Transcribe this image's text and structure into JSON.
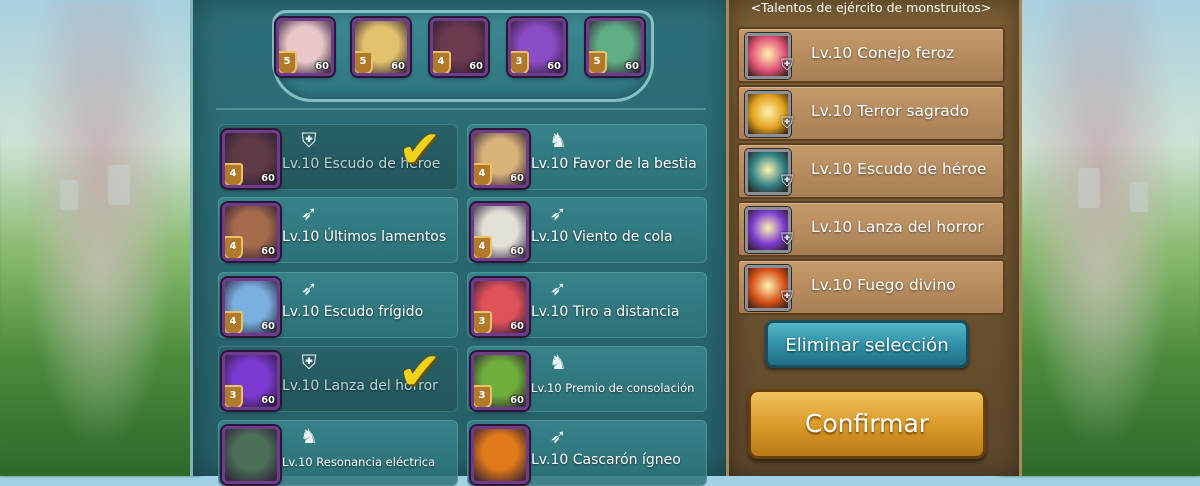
{
  "right_panel": {
    "title": "<Talentos de ejército de monstruitos>",
    "talents": [
      {
        "name": "Lv.10 Conejo feroz",
        "icon": "rabbit-talent-icon",
        "color": "#e3557a"
      },
      {
        "name": "Lv.10 Terror sagrado",
        "icon": "holy-terror-icon",
        "color": "#e0a21e"
      },
      {
        "name": "Lv.10 Escudo de héroe",
        "icon": "hero-shield-icon",
        "color": "#2f7f86"
      },
      {
        "name": "Lv.10 Lanza del horror",
        "icon": "horror-spear-icon",
        "color": "#7b3ad1"
      },
      {
        "name": "Lv.10 Fuego divino",
        "icon": "divine-fire-icon",
        "color": "#d8531a"
      }
    ],
    "clear_button": "Eliminar selección",
    "confirm_button": "Confirmar"
  },
  "squad": [
    {
      "stars": "5",
      "level": "60",
      "color": "#e9c7c9"
    },
    {
      "stars": "5",
      "level": "60",
      "color": "#e2c26c"
    },
    {
      "stars": "4",
      "level": "60",
      "color": "#6a3a4e"
    },
    {
      "stars": "3",
      "level": "60",
      "color": "#8a4cc4"
    },
    {
      "stars": "5",
      "level": "60",
      "color": "#5fae86"
    }
  ],
  "familiars": [
    {
      "name": "Lv.10 Escudo de héroe",
      "stars": "4",
      "level": "60",
      "type_icon": "shield-icon",
      "selected": true,
      "color": "#5d3a44"
    },
    {
      "name": "Lv.10 Favor de la bestia",
      "stars": "4",
      "level": "60",
      "type_icon": "horse-icon",
      "selected": false,
      "color": "#d9b27a"
    },
    {
      "name": "Lv.10 Últimos lamentos",
      "stars": "4",
      "level": "60",
      "type_icon": "bow-horse-icon",
      "selected": false,
      "color": "#a56a4a"
    },
    {
      "name": "Lv.10 Viento de cola",
      "stars": "4",
      "level": "60",
      "type_icon": "bow-horse-icon",
      "selected": false,
      "color": "#e3e0d8"
    },
    {
      "name": "Lv.10 Escudo frígido",
      "stars": "4",
      "level": "60",
      "type_icon": "bow-icon",
      "selected": false,
      "color": "#79b0e0"
    },
    {
      "name": "Lv.10 Tiro a distancia",
      "stars": "3",
      "level": "60",
      "type_icon": "bow-icon",
      "selected": false,
      "color": "#e0525a"
    },
    {
      "name": "Lv.10 Lanza del horror",
      "stars": "3",
      "level": "60",
      "type_icon": "shield-icon",
      "selected": true,
      "color": "#7b3ad1"
    },
    {
      "name": "Lv.10 Premio de consolación",
      "stars": "3",
      "level": "60",
      "type_icon": "horse-icon",
      "selected": false,
      "color": "#6fae3a"
    },
    {
      "name": "Lv.10 Resonancia eléctrica",
      "stars": "",
      "level": "",
      "type_icon": "horse-icon",
      "selected": false,
      "color": "#4c6f5a"
    },
    {
      "name": "Lv.10 Cascarón ígneo",
      "stars": "",
      "level": "",
      "type_icon": "bow-horse-icon",
      "selected": false,
      "color": "#e07a1a"
    }
  ]
}
